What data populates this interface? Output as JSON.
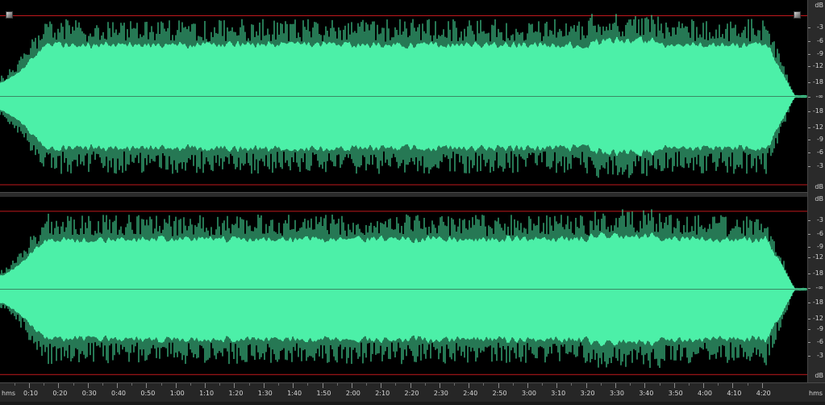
{
  "colors": {
    "background": "#000000",
    "waveform": "#4cf0a8",
    "clip_line": "#c0181c",
    "center_line": "#3a8a66",
    "ruler_bg": "#2a2a2a",
    "ruler_text": "#d0d0d0"
  },
  "db_ruler": {
    "unit": "dB",
    "labels": [
      "-3",
      "-6",
      "-9",
      "-12",
      "-18",
      "-∞",
      "-18",
      "-12",
      "-9",
      "-6",
      "-3"
    ]
  },
  "time_ruler": {
    "unit_label_start": "hms",
    "unit_label_end": "hms",
    "labels": [
      "0:10",
      "0:20",
      "0:30",
      "0:40",
      "0:50",
      "1:00",
      "1:10",
      "1:20",
      "1:30",
      "1:40",
      "1:50",
      "2:00",
      "2:10",
      "2:20",
      "2:30",
      "2:40",
      "2:50",
      "3:00",
      "3:10",
      "3:20",
      "3:30",
      "3:40",
      "3:50",
      "4:00",
      "4:10",
      "4:20"
    ]
  },
  "channels": [
    {
      "id": "left"
    },
    {
      "id": "right"
    }
  ]
}
